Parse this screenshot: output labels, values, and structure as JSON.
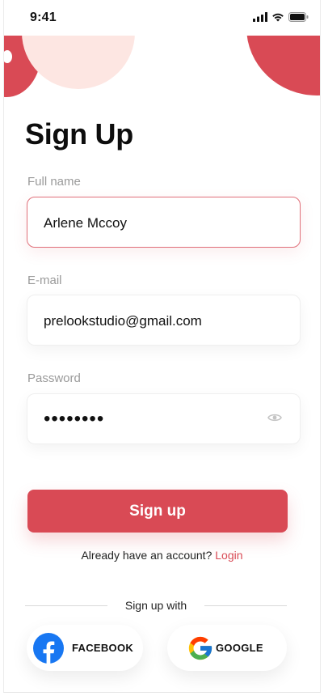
{
  "status_bar": {
    "time": "9:41"
  },
  "page": {
    "title": "Sign Up"
  },
  "form": {
    "full_name": {
      "label": "Full name",
      "value": "Arlene Mccoy"
    },
    "email": {
      "label": "E-mail",
      "value": "prelookstudio@gmail.com"
    },
    "password": {
      "label": "Password",
      "value": "••••••••"
    }
  },
  "signup_button": {
    "label": "Sign up"
  },
  "account_prompt": {
    "text": "Already have an account?",
    "link": "Login"
  },
  "social": {
    "divider_text": "Sign up with",
    "facebook": {
      "label": "FACEBOOK",
      "icon": "facebook-icon"
    },
    "google": {
      "label": "GOOGLE",
      "icon": "google-icon"
    }
  },
  "colors": {
    "accent": "#d94a55",
    "accent_soft": "#fde6e2",
    "facebook_blue": "#1877f2"
  }
}
